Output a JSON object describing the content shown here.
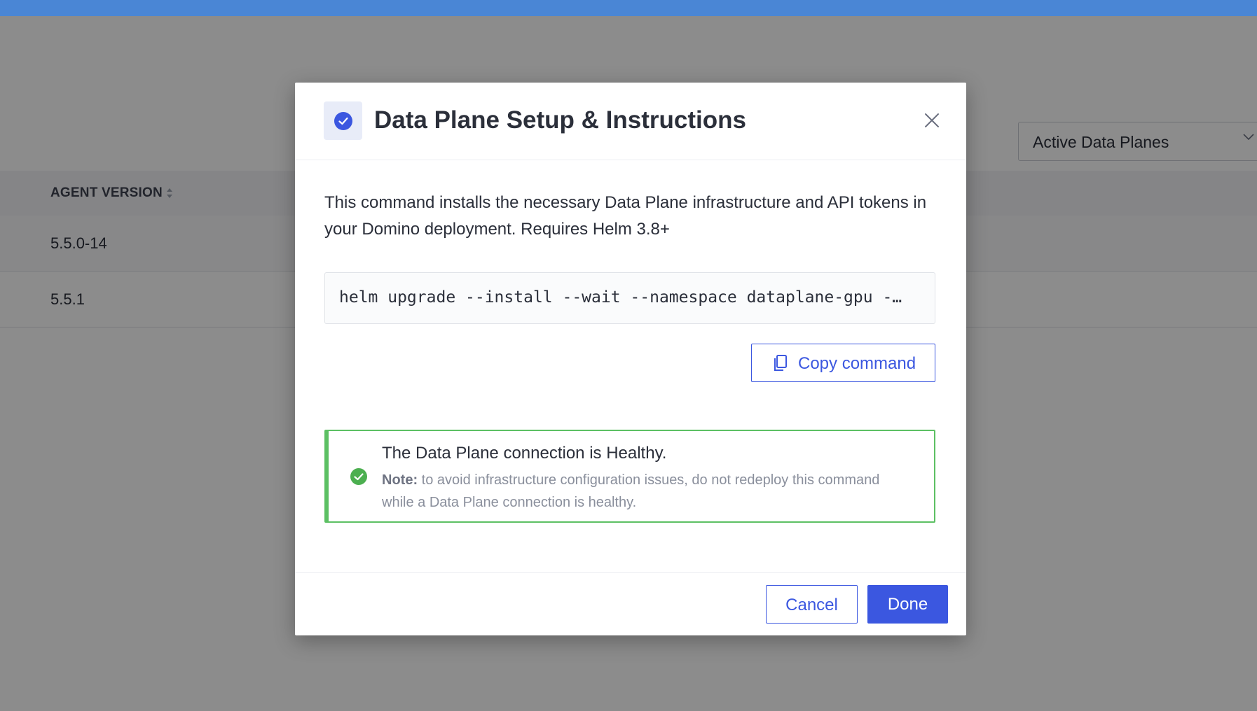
{
  "colors": {
    "topbar": "#4a86d5",
    "primary": "#3b57e0",
    "success": "#5cc063",
    "overlay": "rgba(0,0,0,0.45)"
  },
  "background": {
    "filter_select": {
      "value": "Active Data Planes",
      "icon": "chevron-down-icon"
    },
    "table": {
      "columns": [
        {
          "label": "AGENT VERSION",
          "sort_icon": "sort-icon"
        }
      ],
      "rows": [
        {
          "agent_version": "5.5.0-14"
        },
        {
          "agent_version": "5.5.1"
        }
      ]
    }
  },
  "modal": {
    "title": "Data Plane Setup & Instructions",
    "title_icon": "check-circle-icon",
    "close_icon": "close-icon",
    "description": "This command installs the necessary Data Plane infrastructure and API tokens in your Domino deployment. Requires Helm 3.8+",
    "command": "helm upgrade --install --wait --namespace dataplane-gpu -…",
    "copy_button": {
      "label": "Copy command",
      "icon": "copy-icon"
    },
    "status": {
      "icon": "success-check-icon",
      "title": "The Data Plane connection is Healthy.",
      "note_label": "Note:",
      "note_text": "to avoid infrastructure configuration issues, do not redeploy this command while a Data Plane connection is healthy."
    },
    "footer": {
      "cancel_label": "Cancel",
      "done_label": "Done"
    }
  }
}
